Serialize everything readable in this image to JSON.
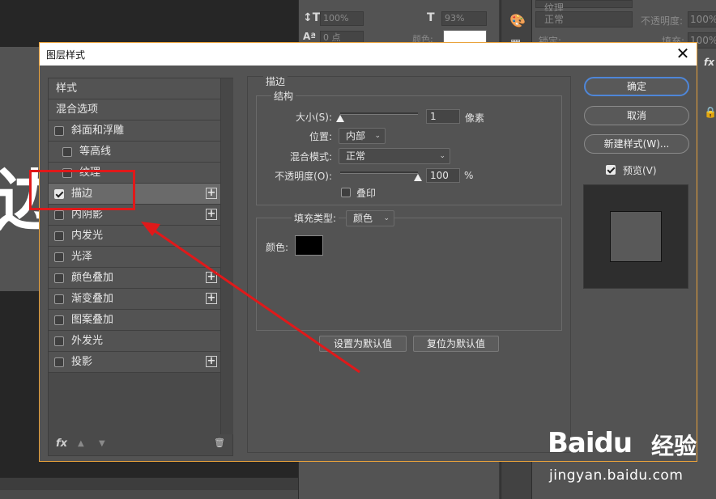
{
  "background": {
    "canvas_glyph": "边",
    "char_panel": {
      "leading": "100%",
      "tracking": "93%",
      "baseline": "0 点",
      "color_label": "颜色:"
    },
    "layers_panel": {
      "blend_mode": "正常",
      "opacity_label": "不透明度:",
      "opacity_value": "100%",
      "lock_label": "锁定:",
      "fill_label": "填充:",
      "fill_value": "100%",
      "top_value": "纹理"
    }
  },
  "dialog": {
    "title": "图层样式",
    "close_symbol": "✕",
    "style_list": [
      {
        "label": "样式",
        "kind": "plain",
        "checked": null,
        "has_plus": false,
        "selected": false
      },
      {
        "label": "混合选项",
        "kind": "plain",
        "checked": null,
        "has_plus": false,
        "selected": false
      },
      {
        "label": "斜面和浮雕",
        "kind": "item",
        "checked": false,
        "has_plus": false,
        "selected": false
      },
      {
        "label": "等高线",
        "kind": "sub",
        "checked": false,
        "has_plus": false,
        "selected": false
      },
      {
        "label": "纹理",
        "kind": "sub",
        "checked": false,
        "has_plus": false,
        "selected": false
      },
      {
        "label": "描边",
        "kind": "item",
        "checked": true,
        "has_plus": true,
        "selected": true
      },
      {
        "label": "内阴影",
        "kind": "item",
        "checked": false,
        "has_plus": true,
        "selected": false
      },
      {
        "label": "内发光",
        "kind": "item",
        "checked": false,
        "has_plus": false,
        "selected": false
      },
      {
        "label": "光泽",
        "kind": "item",
        "checked": false,
        "has_plus": false,
        "selected": false
      },
      {
        "label": "颜色叠加",
        "kind": "item",
        "checked": false,
        "has_plus": true,
        "selected": false
      },
      {
        "label": "渐变叠加",
        "kind": "item",
        "checked": false,
        "has_plus": true,
        "selected": false
      },
      {
        "label": "图案叠加",
        "kind": "item",
        "checked": false,
        "has_plus": false,
        "selected": false
      },
      {
        "label": "外发光",
        "kind": "item",
        "checked": false,
        "has_plus": false,
        "selected": false
      },
      {
        "label": "投影",
        "kind": "item",
        "checked": false,
        "has_plus": true,
        "selected": false
      }
    ],
    "list_footer": {
      "fx_label": "fx",
      "up_icon": "▲",
      "down_icon": "▼",
      "trash_icon": "🗑"
    },
    "stroke": {
      "section_title": "描边",
      "structure_title": "结构",
      "size_label": "大小(S):",
      "size_value": "1",
      "size_unit": "像素",
      "size_slider_fraction": 0.0,
      "position_label": "位置:",
      "position_value": "内部",
      "blend_label": "混合模式:",
      "blend_value": "正常",
      "opacity_label": "不透明度(O):",
      "opacity_value": "100",
      "opacity_unit": "%",
      "opacity_slider_fraction": 1.0,
      "overprint_label": "叠印",
      "overprint_checked": false,
      "fill_type_label": "填充类型:",
      "fill_type_value": "颜色",
      "color_label": "颜色:",
      "color_hex": "#000000",
      "set_default_label": "设置为默认值",
      "reset_default_label": "复位为默认值"
    },
    "buttons": {
      "ok": "确定",
      "cancel": "取消",
      "new_style": "新建样式(W)...",
      "preview_label": "预览(V)",
      "preview_checked": true
    }
  },
  "watermark": {
    "logo": "Baidu",
    "logo_suffix": "经验",
    "url": "jingyan.baidu.com"
  },
  "colors": {
    "dialog_border": "#e9a23b",
    "annotation_red": "#e0191a",
    "primary_button_border": "#4e86d8"
  }
}
